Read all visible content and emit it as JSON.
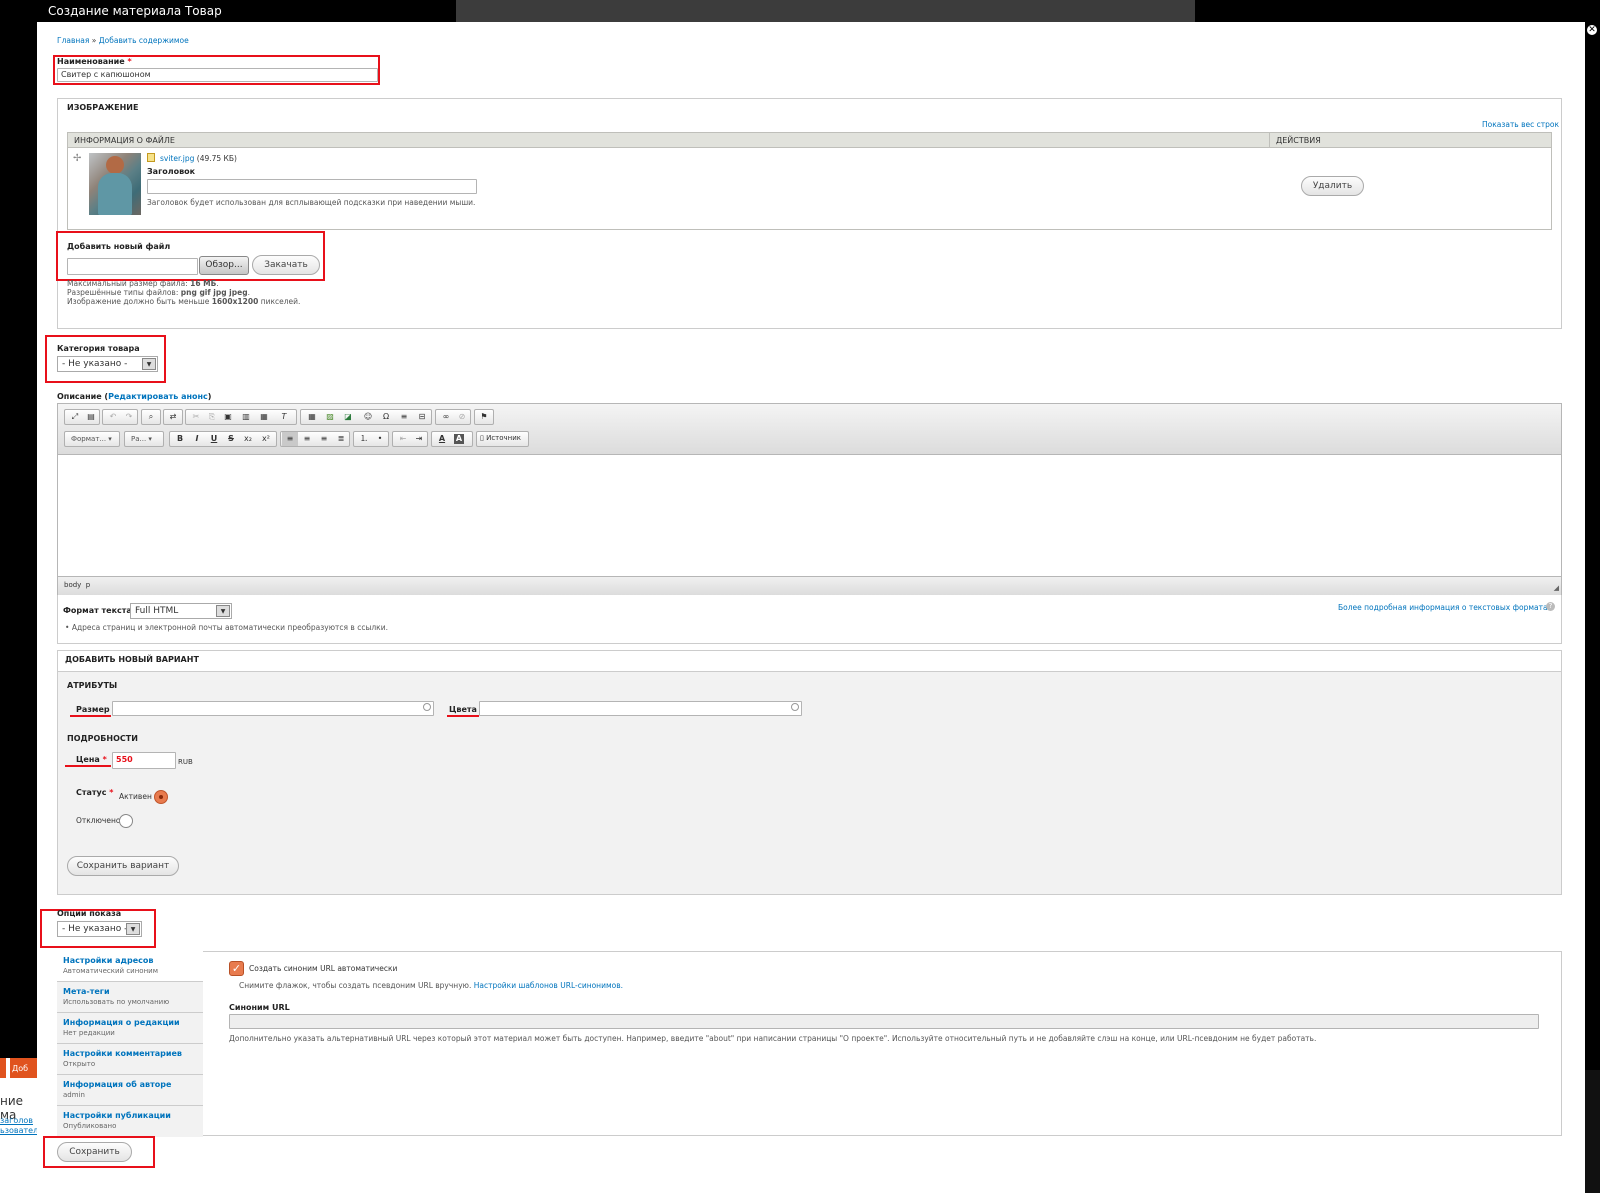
{
  "window": {
    "title": "Создание материала Товар"
  },
  "breadcrumb": {
    "home": "Главная",
    "sep": "»",
    "current": "Добавить содержимое"
  },
  "name_field": {
    "label": "Наименование",
    "required": "*",
    "value": "Свитер с капюшоном"
  },
  "image": {
    "legend": "ИЗОБРАЖЕНИЕ",
    "show_weights": "Показать вес строк",
    "col_file": "ИНФОРМАЦИЯ О ФАЙЛЕ",
    "col_actions": "ДЕЙСТВИЯ",
    "file_name": "sviter.jpg",
    "file_size": "(49.75 КБ)",
    "title_label": "Заголовок",
    "title_value": "",
    "title_hint": "Заголовок будет использован для всплывающей подсказки при наведении мыши.",
    "remove_button": "Удалить",
    "add_label": "Добавить новый файл",
    "browse_button": "Обзор...",
    "upload_button": "Закачать",
    "max_size_text": "Максимальный размер файла:",
    "max_size_value": "16 МБ",
    "types_text": "Разрешённые типы файлов:",
    "types_value": "png gif jpg jpeg",
    "dims_text": "Изображение должно быть меньше",
    "dims_value": "1600x1200",
    "dims_unit": "пикселей."
  },
  "category": {
    "label": "Категория товара",
    "value": "- Не указано -"
  },
  "description": {
    "label": "Описание",
    "edit_summary": "Редактировать анонс",
    "format_combo": "Формат...",
    "size_combo": "Ра...",
    "source_button": "Источник",
    "path_body": "body",
    "path_p": "p",
    "text_format_label": "Формат текста",
    "text_format_value": "Full HTML",
    "more_info": "Более подробная информация о текстовых форматах",
    "tip": "Адреса страниц и электронной почты автоматически преобразуются в ссылки."
  },
  "variant": {
    "legend": "ДОБАВИТЬ НОВЫЙ ВАРИАНТ",
    "attributes_legend": "АТРИБУТЫ",
    "size_label": "Размер",
    "color_label": "Цвета",
    "details_legend": "ПОДРОБНОСТИ",
    "price_label": "Цена",
    "price_value": "550",
    "currency": "RUB",
    "status_label": "Статус",
    "status_active": "Активен",
    "status_disabled": "Отключено",
    "save_variant": "Сохранить вариант"
  },
  "display_options": {
    "label": "Опции показа",
    "value": "- Не указано -"
  },
  "vertical_tabs": [
    {
      "title": "Настройки адресов",
      "summary": "Автоматический синоним"
    },
    {
      "title": "Мета-теги",
      "summary": "Использовать по умолчанию"
    },
    {
      "title": "Информация о редакции",
      "summary": "Нет редакции"
    },
    {
      "title": "Настройки комментариев",
      "summary": "Открыто"
    },
    {
      "title": "Информация об авторе",
      "summary": "admin"
    },
    {
      "title": "Настройки публикации",
      "summary": "Опубликовано"
    }
  ],
  "url_settings": {
    "auto_alias_label": "Создать синоним URL автоматически",
    "uncheck_hint": "Снимите флажок, чтобы создать псевдоним URL вручную.",
    "patterns_link": "Настройки шаблонов URL-синонимов.",
    "alias_label": "Синоним URL",
    "alias_value": "",
    "alias_hint": "Дополнительно указать альтернативный URL через который этот материал может быть доступен. Например, введите \"about\" при написании страницы \"О проекте\". Используйте относительный путь и не добавляйте слэш на конце, или URL-псевдоним не будет работать."
  },
  "save_button": "Сохранить",
  "background_page": {
    "tab": "Доб",
    "heading": "ние ма",
    "link1": "заголов",
    "link2": "ьзовател"
  },
  "colors": {
    "annotation": "#e8101a",
    "link": "#0074bd",
    "radio_on": "#e87b4e"
  }
}
